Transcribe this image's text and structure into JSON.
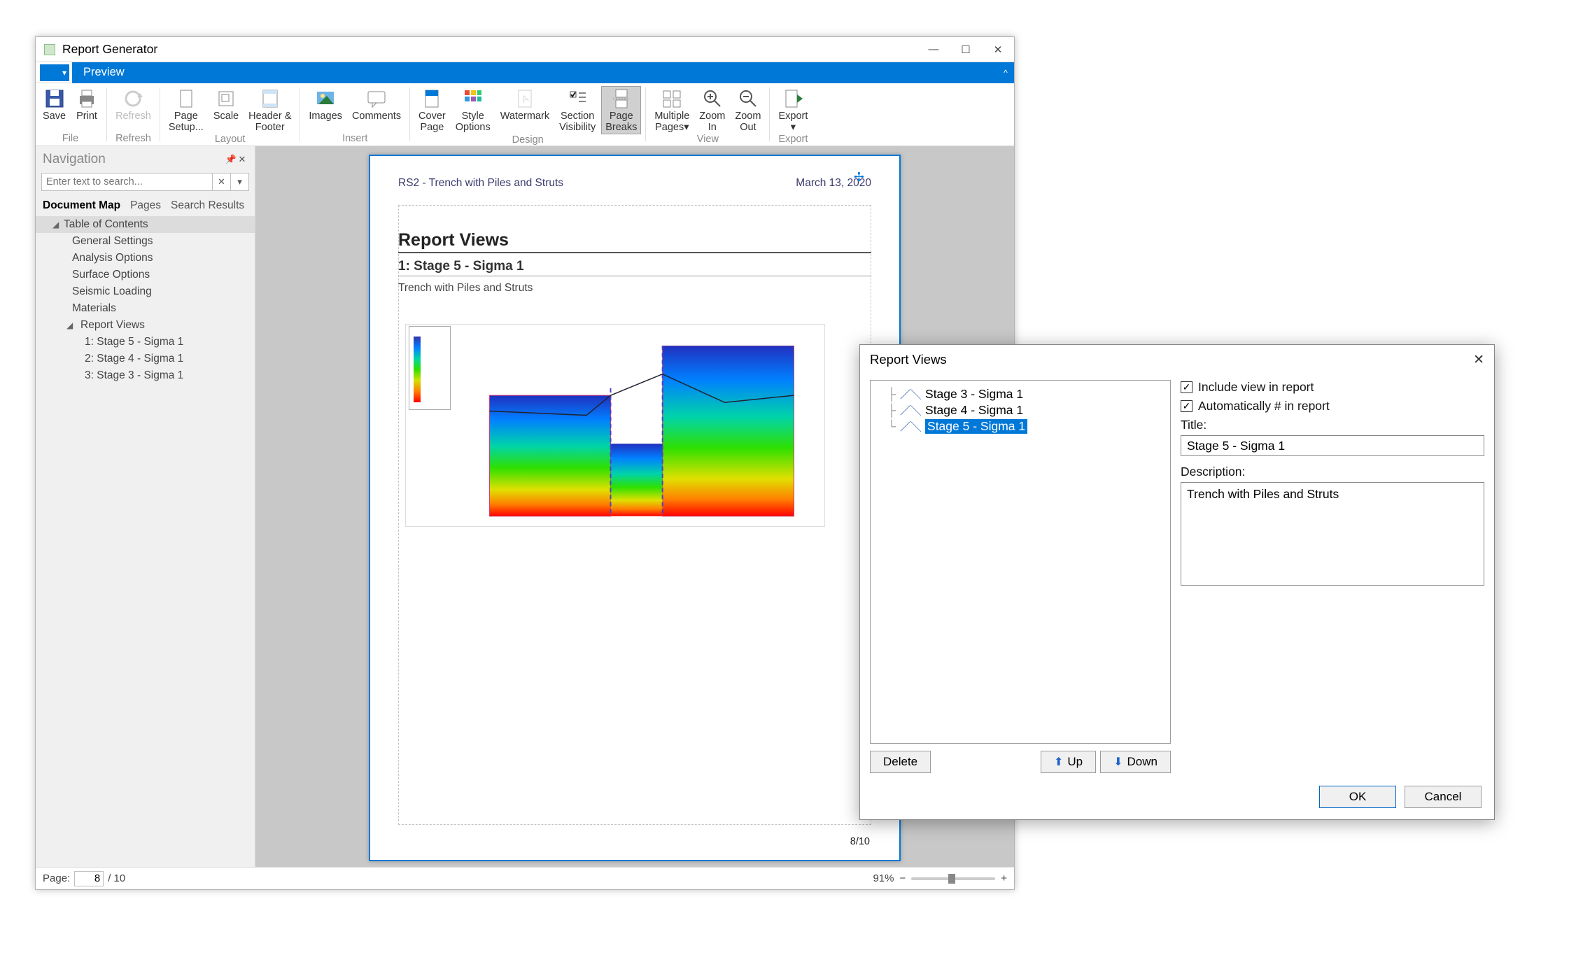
{
  "window": {
    "title": "Report Generator"
  },
  "tabs": {
    "preview": "Preview"
  },
  "ribbon": {
    "save": "Save",
    "print": "Print",
    "refresh": "Refresh",
    "page_setup": "Page\nSetup...",
    "scale": "Scale",
    "header_footer": "Header &\nFooter",
    "images": "Images",
    "comments": "Comments",
    "cover_page": "Cover\nPage",
    "style_options": "Style\nOptions",
    "watermark": "Watermark",
    "section_visibility": "Section\nVisibility",
    "page_breaks": "Page\nBreaks",
    "multiple_pages": "Multiple\nPages▾",
    "zoom_in": "Zoom\nIn",
    "zoom_out": "Zoom\nOut",
    "export": "Export\n▾",
    "g_file": "File",
    "g_refresh": "Refresh",
    "g_layout": "Layout",
    "g_insert": "Insert",
    "g_design": "Design",
    "g_view": "View",
    "g_export": "Export"
  },
  "nav": {
    "title": "Navigation",
    "search_placeholder": "Enter text to search...",
    "tab_docmap": "Document Map",
    "tab_pages": "Pages",
    "tab_results": "Search Results",
    "toc": "Table of Contents",
    "entries": [
      "General Settings",
      "Analysis Options",
      "Surface Options",
      "Seismic Loading",
      "Materials"
    ],
    "report_views": "Report Views",
    "views": [
      "1: Stage 5 - Sigma 1",
      "2: Stage 4 - Sigma 1",
      "3: Stage 3 - Sigma 1"
    ]
  },
  "doc": {
    "header_left": "RS2 - Trench with Piles and Struts",
    "header_right": "March 13, 2020",
    "title": "Report Views",
    "subtitle": "1: Stage 5 - Sigma 1",
    "desc": "Trench with Piles and Struts",
    "pager": "8/10"
  },
  "status": {
    "page_label": "Page:",
    "page_val": "8",
    "page_total": "/ 10",
    "zoom": "91%"
  },
  "dialog": {
    "title": "Report Views",
    "items": [
      "Stage 3 - Sigma 1",
      "Stage 4 - Sigma 1",
      "Stage 5 - Sigma 1"
    ],
    "selected_index": 2,
    "delete": "Delete",
    "up": "Up",
    "down": "Down",
    "include": "Include view in report",
    "autonum": "Automatically # in report",
    "title_label": "Title:",
    "title_val": "Stage 5 - Sigma 1",
    "desc_label": "Description:",
    "desc_val": "Trench with Piles and Struts",
    "ok": "OK",
    "cancel": "Cancel"
  }
}
